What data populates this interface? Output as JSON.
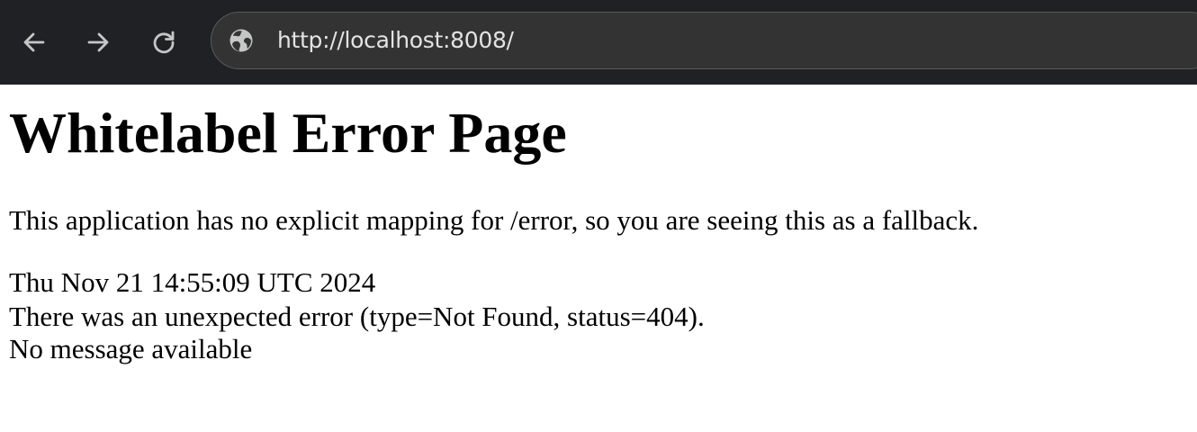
{
  "browser": {
    "url": "http://localhost:8008/",
    "icons": {
      "back": "arrow-left-icon",
      "forward": "arrow-right-icon",
      "reload": "reload-icon",
      "site_info": "globe-icon"
    },
    "colors": {
      "toolbar_bg": "#202124",
      "omnibox_bg": "#333333",
      "icon": "#c4c7c5",
      "url_text": "#e3e3e3"
    }
  },
  "page": {
    "title": "Whitelabel Error Page",
    "explanation": "This application has no explicit mapping for /error, so you are seeing this as a fallback.",
    "timestamp": "Thu Nov 21 14:55:09 UTC 2024",
    "error_detail": "There was an unexpected error (type=Not Found, status=404).",
    "message": "No message available"
  }
}
